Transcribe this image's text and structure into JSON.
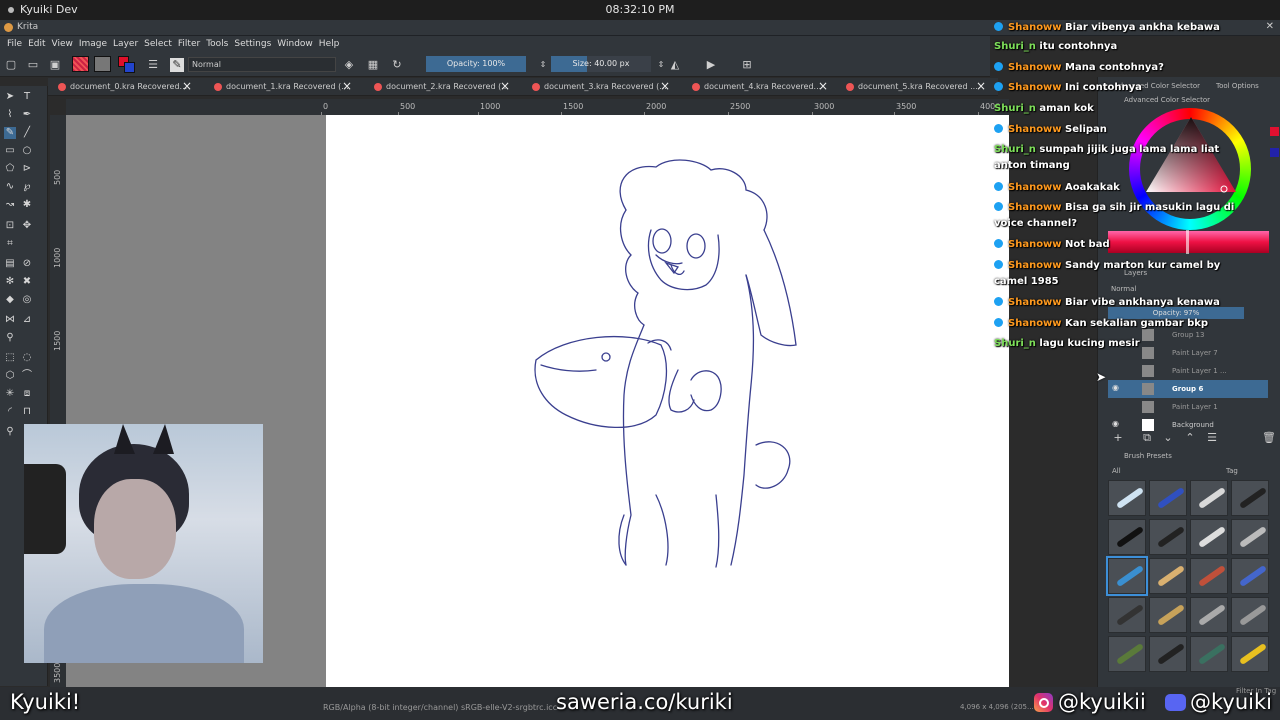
{
  "desktop": {
    "window_title": "Kyuiki Dev",
    "clock": "08:32:10 PM"
  },
  "app": {
    "title": "Krita"
  },
  "menu": [
    "File",
    "Edit",
    "View",
    "Image",
    "Layer",
    "Select",
    "Filter",
    "Tools",
    "Settings",
    "Window",
    "Help"
  ],
  "toolbar": {
    "blend_mode": "Normal",
    "opacity_label": "Opacity: 100%",
    "size_label": "Size: 40.00 px",
    "size_fraction": 0.36
  },
  "tabs": [
    "document_0.kra Recovered...",
    "document_1.kra Recovered (...",
    "document_2.kra Recovered (...",
    "document_3.kra Recovered (...",
    "document_4.kra Recovered...",
    "document_5.kra Recovered ..."
  ],
  "ruler": {
    "top": [
      "0",
      "500",
      "1000",
      "1500",
      "2000",
      "2500",
      "3000",
      "3500",
      "4000"
    ],
    "left": [
      "500",
      "1000",
      "1500",
      "3500"
    ]
  },
  "dock": {
    "color_selector_title": "Advanced Color Selector",
    "color_selector_tab": "Advanced Color Selector",
    "tool_options_tab": "Tool Options",
    "layers_title": "Layers",
    "layers_blend": "Normal",
    "layers_opacity": "Opacity: 97%",
    "layers": [
      {
        "name": "Group 13",
        "visible": false,
        "selected": false
      },
      {
        "name": "Paint Layer 7",
        "visible": false,
        "selected": false
      },
      {
        "name": "Paint Layer 1 ...",
        "visible": false,
        "selected": false
      },
      {
        "name": "Group 6",
        "visible": true,
        "selected": true
      },
      {
        "name": "Paint Layer 1",
        "visible": false,
        "selected": false
      },
      {
        "name": "Background",
        "visible": true,
        "selected": false
      }
    ],
    "brush_presets_title": "Brush Presets",
    "brush_filter": "All",
    "brush_tag": "Tag",
    "filter_in_tag": "Filter In Tag"
  },
  "chat": [
    {
      "user": "Shanoww",
      "text": "Biar vibenya ankha kebawa",
      "badge": true
    },
    {
      "user": "Shuri_n",
      "text": "itu contohnya",
      "badge": false
    },
    {
      "user": "Shanoww",
      "text": "Mana contohnya?",
      "badge": true
    },
    {
      "user": "Shanoww",
      "text": "Ini contohnya",
      "badge": true
    },
    {
      "user": "Shuri_n",
      "text": "aman kok",
      "badge": false
    },
    {
      "user": "Shanoww",
      "text": "Selipan",
      "badge": true
    },
    {
      "user": "Shuri_n",
      "text": "sumpah jijik juga lama lama liat anton timang",
      "badge": false
    },
    {
      "user": "Shanoww",
      "text": "Aoakakak",
      "badge": true
    },
    {
      "user": "Shanoww",
      "text": "Bisa ga sih jir masukin lagu di voice channel?",
      "badge": true
    },
    {
      "user": "Shanoww",
      "text": "Not bad",
      "badge": true
    },
    {
      "user": "Shanoww",
      "text": "Sandy marton kur camel by camel 1985",
      "badge": true
    },
    {
      "user": "Shanoww",
      "text": "Biar vibe ankhanya kenawa",
      "badge": true
    },
    {
      "user": "Shanoww",
      "text": "Kan sekalian gambar bkp",
      "badge": true
    },
    {
      "user": "Shuri_n",
      "text": "lagu kucing mesir",
      "badge": false
    }
  ],
  "status": {
    "color_info": "RGB/Alpha (8-bit integer/channel)  sRGB-elle-V2-srgbtrc.icc",
    "dimensions": "4,096 x 4,096 (205..."
  },
  "overlay": {
    "streamer": "Kyuiki!",
    "donation": "saweria.co/kuriki",
    "instagram": "@kyuikii",
    "discord": "@kyuiki"
  },
  "colors": {
    "accent": "#3d6a93",
    "shanoww": "#ff9a1f",
    "shuri": "#7ee05a",
    "stroke": "#3a3f8f"
  }
}
